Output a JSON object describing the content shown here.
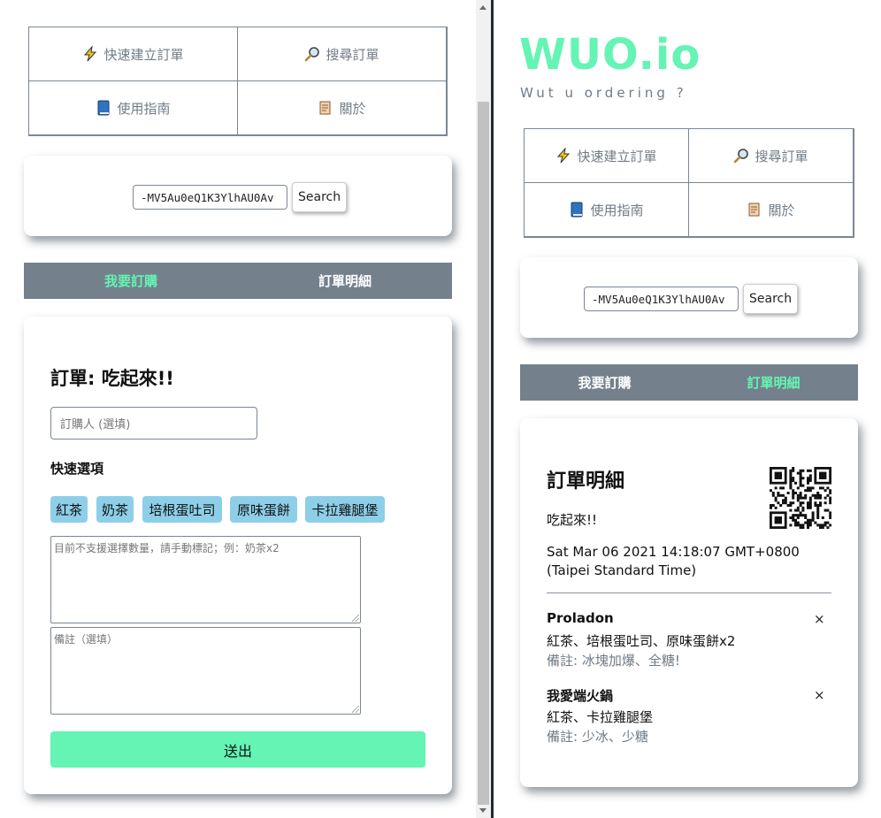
{
  "menu": {
    "quick_create": "快速建立訂單",
    "search_order": "搜尋訂單",
    "guide": "使用指南",
    "about": "關於"
  },
  "search": {
    "value": "-MV5Au0eQ1K3YlhAU0Av",
    "button": "Search"
  },
  "tabs": {
    "order": "我要訂購",
    "details": "訂單明細"
  },
  "left": {
    "active_tab": "order",
    "order_title": "訂單: 吃起來!!",
    "name_placeholder": "訂購人 (選填)",
    "quick_options_title": "快速選項",
    "quick_options": [
      "紅茶",
      "奶茶",
      "培根蛋吐司",
      "原味蛋餅",
      "卡拉雞腿堡"
    ],
    "items_placeholder": "目前不支援選擇數量，請手動標記；例：奶茶x2",
    "note_placeholder": "備註（選填）",
    "submit": "送出"
  },
  "right": {
    "logo": "WUO.io",
    "tagline": "Wut u ordering ?",
    "active_tab": "details",
    "details_title": "訂單明細",
    "order_name": "吃起來!!",
    "timestamp": "Sat Mar 06 2021 14:18:07 GMT+0800 (Taipei Standard Time)",
    "entries": [
      {
        "name": "Proladon",
        "items": "紅茶、培根蛋吐司、原味蛋餅x2",
        "note": "備註: 冰塊加爆、全糖!",
        "remove": "×"
      },
      {
        "name": "我愛端火鍋",
        "items": "紅茶、卡拉雞腿堡",
        "note": "備註: 少冰、少糖",
        "remove": "×"
      }
    ]
  },
  "colors": {
    "accent": "#64f4b4",
    "tabbar": "#74818c",
    "chip": "#8dcfe8",
    "muted_text": "#707b86"
  },
  "icons": {
    "quick_create": "lightning-icon",
    "search_order": "magnifier-icon",
    "guide": "book-icon",
    "about": "scroll-icon",
    "qr": "qr-code-icon"
  }
}
